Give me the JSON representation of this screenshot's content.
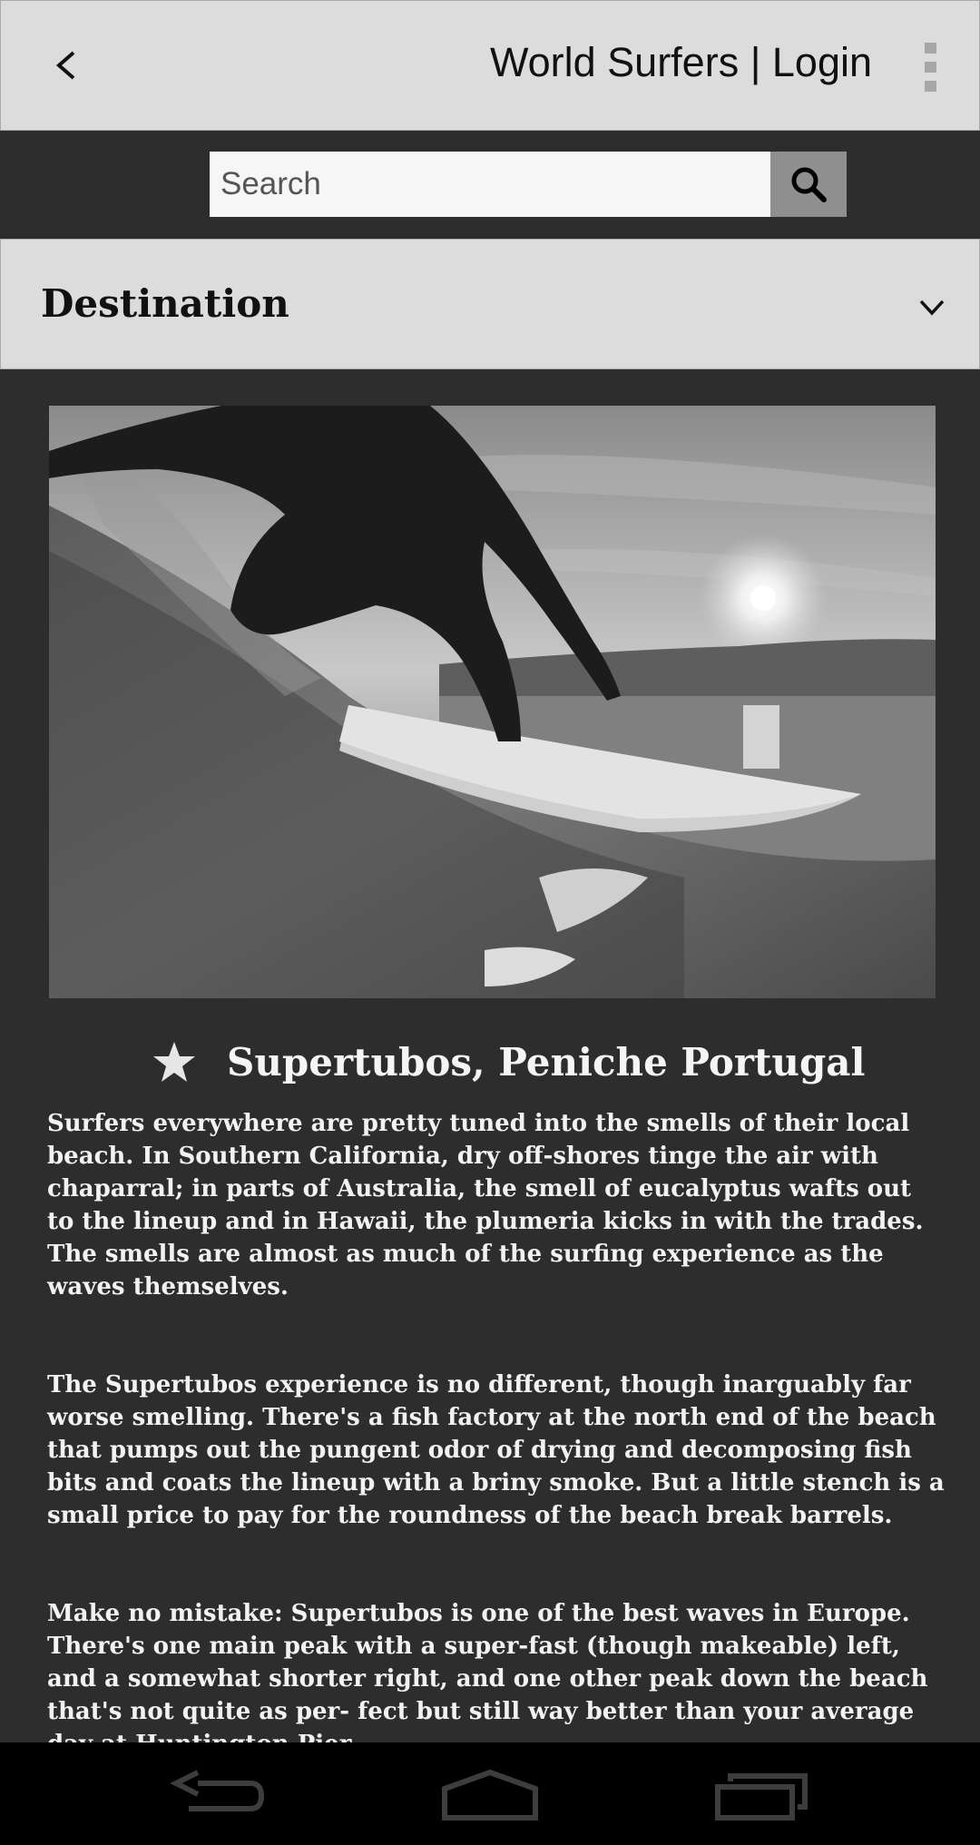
{
  "header": {
    "title": "World Surfers | Login",
    "back_icon": "chevron-left-icon",
    "menu_icon": "overflow-menu-icon"
  },
  "search": {
    "placeholder": "Search",
    "button_icon": "search-icon"
  },
  "destination": {
    "label": "Destination",
    "chevron_icon": "chevron-down-icon"
  },
  "photo": {
    "description_icon": "surfer-photo"
  },
  "spot": {
    "favorite_icon": "star-icon",
    "title": "Supertubos, Peniche Portugal"
  },
  "article": {
    "paragraphs": [
      "Surfers everywhere are pretty tuned into the smells of their local beach. In Southern California, dry off-shores tinge the air with chaparral; in parts of Australia, the smell of eucalyptus wafts out to the lineup and in Hawaii, the plumeria kicks in with the trades. The smells are almost as much of the surfing experience as the waves themselves.",
      "The Supertubos experience is no different, though inarguably far worse smelling. There's a fish factory at the north end of the beach that pumps out the pungent odor of drying and decomposing fish bits and coats the lineup with a briny smoke. But a little stench is a small price to pay for the roundness of the beach break barrels.",
      "Make no mistake: Supertubos is one of the best waves in Europe. There's one main peak with a super-fast (though makeable) left, and a somewhat shorter right, and one other peak down the beach that's not quite as per- fect but still way better than your average day at Huntington Pier."
    ]
  },
  "navbar": {
    "back_icon": "back-nav-icon",
    "home_icon": "home-nav-icon",
    "recents_icon": "recents-nav-icon"
  },
  "colors": {
    "background": "#2d2d2d",
    "bar": "#dcdcdc",
    "search_button": "#8f8f8f",
    "text_light": "#f2f2f2"
  }
}
